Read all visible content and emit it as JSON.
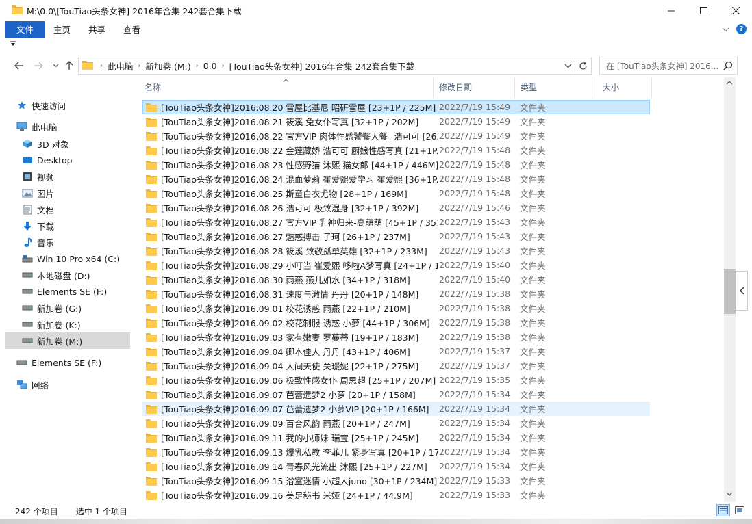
{
  "window": {
    "title": "M:\\0.0\\[TouTiao头条女神] 2016年合集 242套合集下载"
  },
  "ribbon": {
    "tabs": [
      "文件",
      "主页",
      "共享",
      "查看"
    ]
  },
  "address": {
    "crumbs": [
      "此电脑",
      "新加卷 (M:)",
      "0.0",
      "[TouTiao头条女神] 2016年合集 242套合集下载"
    ],
    "search_placeholder": "在 [TouTiao头条女神] 2016..."
  },
  "nav": {
    "items": [
      {
        "label": "快速访问",
        "icon": "star-icon"
      },
      {
        "label": "此电脑",
        "icon": "computer-icon"
      },
      {
        "label": "3D 对象",
        "icon": "3d-objects-icon"
      },
      {
        "label": "Desktop",
        "icon": "desktop-icon"
      },
      {
        "label": "视频",
        "icon": "video-icon"
      },
      {
        "label": "图片",
        "icon": "pictures-icon"
      },
      {
        "label": "文档",
        "icon": "documents-icon"
      },
      {
        "label": "下载",
        "icon": "download-icon"
      },
      {
        "label": "音乐",
        "icon": "music-icon"
      },
      {
        "label": "Win 10 Pro x64 (C:)",
        "icon": "drive-windows-icon"
      },
      {
        "label": "本地磁盘 (D:)",
        "icon": "drive-icon"
      },
      {
        "label": "Elements SE (F:)",
        "icon": "drive-icon"
      },
      {
        "label": "新加卷 (G:)",
        "icon": "drive-icon"
      },
      {
        "label": "新加卷 (K:)",
        "icon": "drive-icon"
      },
      {
        "label": "新加卷 (M:)",
        "icon": "drive-icon",
        "selected": true
      },
      {
        "label": "Elements SE (F:)",
        "icon": "drive-icon"
      },
      {
        "label": "网络",
        "icon": "network-icon"
      }
    ]
  },
  "columns": {
    "name": "名称",
    "date": "修改日期",
    "type": "类型",
    "size": "大小"
  },
  "files": [
    {
      "name": "[TouTiao头条女神]2016.08.20 雪屋比基尼 昭研雪屋 [23+1P / 225M]",
      "date": "2022/7/19 15:49",
      "type": "文件夹"
    },
    {
      "name": "[TouTiao头条女神]2016.08.21 筱溪 兔女仆写真 [32+1P / 202M]",
      "date": "2022/7/19 15:49",
      "type": "文件夹"
    },
    {
      "name": "[TouTiao头条女神]2016.08.22 官方VIP 肉体性感饕餮大餐--浩可可 [26...",
      "date": "2022/7/19 15:49",
      "type": "文件夹"
    },
    {
      "name": "[TouTiao头条女神]2016.08.22 金莲藏娇 浩可可 厨娘性感写真 [21+1P...",
      "date": "2022/7/19 15:48",
      "type": "文件夹"
    },
    {
      "name": "[TouTiao头条女神]2016.08.23 性感野猫 沐熙 猫女郎 [44+1P / 446M]",
      "date": "2022/7/19 15:48",
      "type": "文件夹"
    },
    {
      "name": "[TouTiao头条女神]2016.08.24 混血萝莉 崔爱熙爱学习 崔爱熙 [36+1P...",
      "date": "2022/7/19 15:48",
      "type": "文件夹"
    },
    {
      "name": "[TouTiao头条女神]2016.08.25 斯童白衣尤物 [28+1P / 169M]",
      "date": "2022/7/19 15:48",
      "type": "文件夹"
    },
    {
      "name": "[TouTiao头条女神]2016.08.26 浩可可 极致湿身 [32+1P / 392M]",
      "date": "2022/7/19 15:46",
      "type": "文件夹"
    },
    {
      "name": "[TouTiao头条女神]2016.08.27 官方VIP 乳神归来-高萌萌 [45+1P / 351...",
      "date": "2022/7/19 15:43",
      "type": "文件夹"
    },
    {
      "name": "[TouTiao头条女神]2016.08.27 魅惑搏击 子珂 [26+1P / 237M]",
      "date": "2022/7/19 15:43",
      "type": "文件夹"
    },
    {
      "name": "[TouTiao头条女神]2016.08.28 筱溪 致敬孤单英雄 [32+1P / 233M]",
      "date": "2022/7/19 15:43",
      "type": "文件夹"
    },
    {
      "name": "[TouTiao头条女神]2016.08.29 小叮当 崔爱熙 哆啦A梦写真 [24+1P / 1...",
      "date": "2022/7/19 15:40",
      "type": "文件夹"
    },
    {
      "name": "[TouTiao头条女神]2016.08.30 雨燕 燕儿如水 [34+1P / 318M]",
      "date": "2022/7/19 15:40",
      "type": "文件夹"
    },
    {
      "name": "[TouTiao头条女神]2016.08.31 速度与激情 丹丹 [20+1P / 148M]",
      "date": "2022/7/19 15:38",
      "type": "文件夹"
    },
    {
      "name": "[TouTiao头条女神]2016.09.01 校花诱惑 雨燕 [22+1P / 210M]",
      "date": "2022/7/19 15:38",
      "type": "文件夹"
    },
    {
      "name": "[TouTiao头条女神]2016.09.02 校花制服 诱惑 小萝 [44+1P / 306M]",
      "date": "2022/7/19 15:38",
      "type": "文件夹"
    },
    {
      "name": "[TouTiao头条女神]2016.09.03 家有嫩妻 罗蔓蒂 [19+1P / 183M]",
      "date": "2022/7/19 15:38",
      "type": "文件夹"
    },
    {
      "name": "[TouTiao头条女神]2016.09.04 卿本佳人 丹丹 [43+1P / 406M]",
      "date": "2022/7/19 15:37",
      "type": "文件夹"
    },
    {
      "name": "[TouTiao头条女神]2016.09.04 人间天使 关瑷妮 [22+1P / 275M]",
      "date": "2022/7/19 15:37",
      "type": "文件夹"
    },
    {
      "name": "[TouTiao头条女神]2016.09.06 极致性感女仆 周思超 [25+1P / 207M]",
      "date": "2022/7/19 15:35",
      "type": "文件夹"
    },
    {
      "name": "[TouTiao头条女神]2016.09.07 芭蕾遗梦2 小萝 [20+1P / 158M]",
      "date": "2022/7/19 15:34",
      "type": "文件夹"
    },
    {
      "name": "[TouTiao头条女神]2016.09.07 芭蕾遗梦2 小萝VIP [20+1P / 166M]",
      "date": "2022/7/19 15:34",
      "type": "文件夹"
    },
    {
      "name": "[TouTiao头条女神]2016.09.09 百合风韵 雨燕 [20+1P / 247M]",
      "date": "2022/7/19 15:34",
      "type": "文件夹"
    },
    {
      "name": "[TouTiao头条女神]2016.09.11 我的小师妹 瑞宝 [25+1P / 245M]",
      "date": "2022/7/19 15:34",
      "type": "文件夹"
    },
    {
      "name": "[TouTiao头条女神]2016.09.13 爆乳私教 李菲儿 紧身写真 [20+1P / 17...",
      "date": "2022/7/19 15:34",
      "type": "文件夹"
    },
    {
      "name": "[TouTiao头条女神]2016.09.14 青春风光流出 沐熙 [25+1P / 227M]",
      "date": "2022/7/19 15:34",
      "type": "文件夹"
    },
    {
      "name": "[TouTiao头条女神]2016.09.15 浴室迷情 小超人juno [30+1P / 234M]",
      "date": "2022/7/19 15:33",
      "type": "文件夹"
    },
    {
      "name": "[TouTiao头条女神]2016.09.16 美足秘书 米娅 [24+1P / 44.9M]",
      "date": "2022/7/19 15:33",
      "type": "文件夹"
    }
  ],
  "status": {
    "count": "242 个项目",
    "selected": "选中 1 个项目"
  },
  "colors": {
    "accent": "#1c63c7",
    "folder": "#ffcb4c",
    "selected_row": "#cce8ff"
  }
}
